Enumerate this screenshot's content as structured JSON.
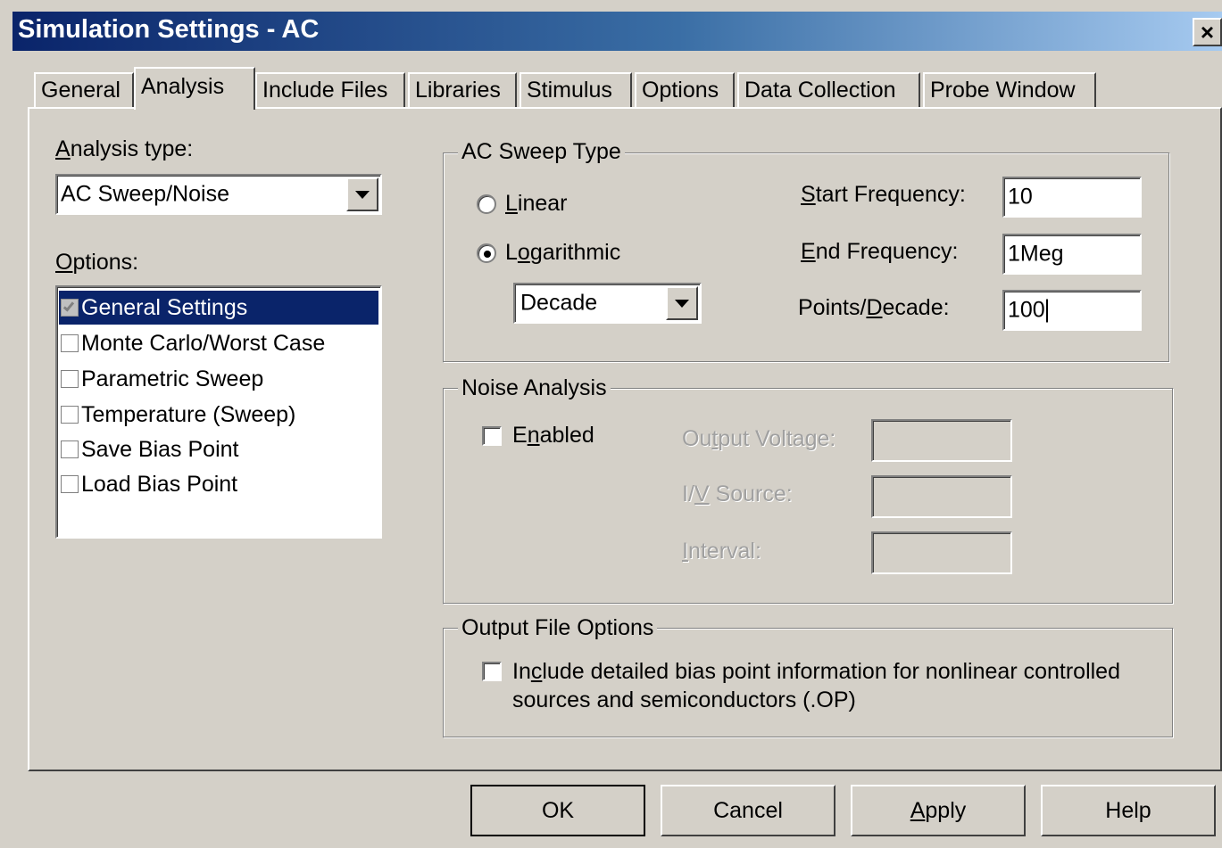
{
  "window": {
    "title": "Simulation Settings - AC",
    "close_label": "×"
  },
  "tabs": [
    {
      "label": "General"
    },
    {
      "label": "Analysis",
      "active": true
    },
    {
      "label": "Include Files"
    },
    {
      "label": "Libraries"
    },
    {
      "label": "Stimulus"
    },
    {
      "label": "Options"
    },
    {
      "label": "Data Collection"
    },
    {
      "label": "Probe Window"
    }
  ],
  "analysis_type": {
    "label_prefix": "A",
    "label_rest": "nalysis type:",
    "value": "AC Sweep/Noise"
  },
  "options": {
    "label_prefix": "O",
    "label_rest": "ptions:",
    "items": [
      {
        "label": "General Settings",
        "checked": true,
        "selected": true
      },
      {
        "label": "Monte Carlo/Worst Case",
        "checked": false
      },
      {
        "label": "Parametric Sweep",
        "checked": false
      },
      {
        "label": "Temperature (Sweep)",
        "checked": false
      },
      {
        "label": "Save Bias Point",
        "checked": false
      },
      {
        "label": "Load Bias Point",
        "checked": false
      }
    ]
  },
  "ac_sweep": {
    "legend": "AC Sweep Type",
    "linear_u": "L",
    "linear_rest": "inear",
    "log_pre": "L",
    "log_u": "o",
    "log_rest": "garithmic",
    "selected": "Logarithmic",
    "sweep_unit": "Decade",
    "start_u": "S",
    "start_rest": "tart Frequency:",
    "start_value": "10",
    "end_u": "E",
    "end_rest": "nd Frequency:",
    "end_value": "1Meg",
    "points_pre": "Points/",
    "points_u": "D",
    "points_rest": "ecade:",
    "points_value": "100"
  },
  "noise": {
    "legend": "Noise Analysis",
    "enabled_pre": "E",
    "enabled_u": "n",
    "enabled_rest": "abled",
    "enabled": false,
    "output_pre": "Ou",
    "output_u": "t",
    "output_rest": "put Voltage:",
    "iv_pre": "I/",
    "iv_u": "V",
    "iv_rest": " Source:",
    "interval_u": "I",
    "interval_rest": "nterval:"
  },
  "output_file": {
    "legend": "Output File Options",
    "line1_pre": "In",
    "line1_u": "c",
    "line1_rest": "lude detailed bias point information for nonlinear controlled",
    "line2": "sources and semiconductors (.OP)",
    "checked": false
  },
  "buttons": {
    "ok": "OK",
    "cancel": "Cancel",
    "apply_u": "A",
    "apply_rest": "pply",
    "help": "Help"
  }
}
